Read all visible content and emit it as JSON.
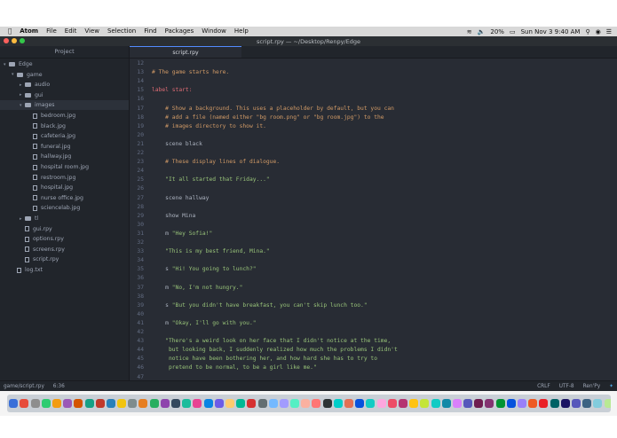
{
  "menubar": {
    "apple": "",
    "app": "Atom",
    "items": [
      "File",
      "Edit",
      "View",
      "Selection",
      "Find",
      "Packages",
      "Window",
      "Help"
    ],
    "battery": "20%",
    "datetime": "Sun Nov 3  9:40 AM"
  },
  "window": {
    "title": "script.rpy — ~/Desktop/Renpy/Edge"
  },
  "tree": {
    "header": "Project",
    "nodes": [
      {
        "label": "Edge",
        "kind": "folder",
        "depth": 0,
        "open": true
      },
      {
        "label": "game",
        "kind": "folder",
        "depth": 1,
        "open": true
      },
      {
        "label": "audio",
        "kind": "folder",
        "depth": 2,
        "open": false
      },
      {
        "label": "gui",
        "kind": "folder",
        "depth": 2,
        "open": false
      },
      {
        "label": "images",
        "kind": "folder",
        "depth": 2,
        "open": true,
        "selected": true
      },
      {
        "label": "bedroom.jpg",
        "kind": "file",
        "depth": 3
      },
      {
        "label": "black.jpg",
        "kind": "file",
        "depth": 3
      },
      {
        "label": "cafeteria.jpg",
        "kind": "file",
        "depth": 3
      },
      {
        "label": "funeral.jpg",
        "kind": "file",
        "depth": 3
      },
      {
        "label": "hallway.jpg",
        "kind": "file",
        "depth": 3
      },
      {
        "label": "hospital room.jpg",
        "kind": "file",
        "depth": 3
      },
      {
        "label": "restroom.jpg",
        "kind": "file",
        "depth": 3
      },
      {
        "label": "hospital.jpg",
        "kind": "file",
        "depth": 3
      },
      {
        "label": "nurse office.jpg",
        "kind": "file",
        "depth": 3
      },
      {
        "label": "sciencelab.jpg",
        "kind": "file",
        "depth": 3
      },
      {
        "label": "tl",
        "kind": "folder",
        "depth": 2,
        "open": false
      },
      {
        "label": "gui.rpy",
        "kind": "file",
        "depth": 2
      },
      {
        "label": "options.rpy",
        "kind": "file",
        "depth": 2
      },
      {
        "label": "screens.rpy",
        "kind": "file",
        "depth": 2
      },
      {
        "label": "script.rpy",
        "kind": "file",
        "depth": 2
      },
      {
        "label": "log.txt",
        "kind": "file",
        "depth": 1
      }
    ]
  },
  "tab": {
    "label": "script.rpy"
  },
  "editor": {
    "lines": [
      {
        "n": "12",
        "t": "",
        "c": "plain"
      },
      {
        "n": "13",
        "t": "# The game starts here.",
        "c": "cmt"
      },
      {
        "n": "14",
        "t": "",
        "c": "plain"
      },
      {
        "n": "15",
        "t": "label start:",
        "c": "kw"
      },
      {
        "n": "16",
        "t": "",
        "c": "plain"
      },
      {
        "n": "17",
        "t": "    # Show a background. This uses a placeholder by default, but you can",
        "c": "cmt"
      },
      {
        "n": "18",
        "t": "    # add a file (named either \"bg room.png\" or \"bg room.jpg\") to the",
        "c": "cmt"
      },
      {
        "n": "19",
        "t": "    # images directory to show it.",
        "c": "cmt"
      },
      {
        "n": "20",
        "t": "",
        "c": "plain"
      },
      {
        "n": "21",
        "t": "    scene black",
        "c": "plain"
      },
      {
        "n": "22",
        "t": "",
        "c": "plain"
      },
      {
        "n": "23",
        "t": "    # These display lines of dialogue.",
        "c": "cmt"
      },
      {
        "n": "24",
        "t": "",
        "c": "plain"
      },
      {
        "n": "25",
        "t": "    \"It all started that Friday...\"",
        "c": "str"
      },
      {
        "n": "26",
        "t": "",
        "c": "plain"
      },
      {
        "n": "27",
        "t": "    scene hallway",
        "c": "plain"
      },
      {
        "n": "28",
        "t": "",
        "c": "plain"
      },
      {
        "n": "29",
        "t": "    show Mina",
        "c": "plain"
      },
      {
        "n": "30",
        "t": "",
        "c": "plain"
      },
      {
        "n": "31",
        "t": "    m \"Hey Sofia!\"",
        "c": "dlg"
      },
      {
        "n": "32",
        "t": "",
        "c": "plain"
      },
      {
        "n": "33",
        "t": "    \"This is my best friend, Mina.\"",
        "c": "str"
      },
      {
        "n": "34",
        "t": "",
        "c": "plain"
      },
      {
        "n": "35",
        "t": "    s \"Hi! You going to lunch?\"",
        "c": "dlg"
      },
      {
        "n": "36",
        "t": "",
        "c": "plain"
      },
      {
        "n": "37",
        "t": "    m \"No, I'm not hungry.\"",
        "c": "dlg"
      },
      {
        "n": "38",
        "t": "",
        "c": "plain"
      },
      {
        "n": "39",
        "t": "    s \"But you didn't have breakfast, you can't skip lunch too.\"",
        "c": "dlg"
      },
      {
        "n": "40",
        "t": "",
        "c": "plain"
      },
      {
        "n": "41",
        "t": "    m \"Okay, I'll go with you.\"",
        "c": "dlg"
      },
      {
        "n": "42",
        "t": "",
        "c": "plain"
      },
      {
        "n": "43",
        "t": "    \"There's a weird look on her face that I didn't notice at the time,",
        "c": "str"
      },
      {
        "n": "44",
        "t": "     but looking back, I suddenly realized how much the problems I didn't",
        "c": "str"
      },
      {
        "n": "45",
        "t": "     notice have been bothering her, and how hard she has to try to",
        "c": "str"
      },
      {
        "n": "46",
        "t": "     pretend to be normal, to be a girl like me.\"",
        "c": "str"
      },
      {
        "n": "47",
        "t": "",
        "c": "plain"
      }
    ]
  },
  "status": {
    "path": "game/script.rpy",
    "cursor": "6:36",
    "line_ending": "CRLF",
    "encoding": "UTF-8",
    "grammar": "Ren'Py"
  },
  "colors": {
    "accent": "#528bff",
    "comment": "#d19a66",
    "string": "#98c379",
    "keyword": "#e06c75"
  },
  "dock": {
    "icon_colors": [
      "#3a6fd8",
      "#e74c3c",
      "#8e8e8e",
      "#2ecc71",
      "#f39c12",
      "#9b59b6",
      "#d35400",
      "#16a085",
      "#c0392b",
      "#2980b9",
      "#f1c40f",
      "#7f8c8d",
      "#e67e22",
      "#27ae60",
      "#8e44ad",
      "#34495e",
      "#1abc9c",
      "#e84393",
      "#0984e3",
      "#6c5ce7",
      "#fdcb6e",
      "#00b894",
      "#d63031",
      "#636e72",
      "#74b9ff",
      "#a29bfe",
      "#55efc4",
      "#fab1a0",
      "#ff7675",
      "#2d3436",
      "#00cec9",
      "#e17055",
      "#0652dd",
      "#12cbc4",
      "#fda7df",
      "#ed4c67",
      "#b53471",
      "#ffc312",
      "#c4e538",
      "#12cbc4",
      "#1289a7",
      "#d980fa",
      "#5758bb",
      "#6f1e51",
      "#833471",
      "#009432",
      "#0652dd",
      "#9980fa",
      "#ee5a24",
      "#ea2027",
      "#006266",
      "#1b1464",
      "#5758bb",
      "#3c6382",
      "#82ccdd",
      "#b8e994",
      "#78e08f",
      "#38ada9",
      "#e55039",
      "#4a69bd",
      "#6a89cc",
      "#60a3bc",
      "#0a3d62",
      "#079992",
      "#b71540",
      "#eb2f06"
    ]
  }
}
